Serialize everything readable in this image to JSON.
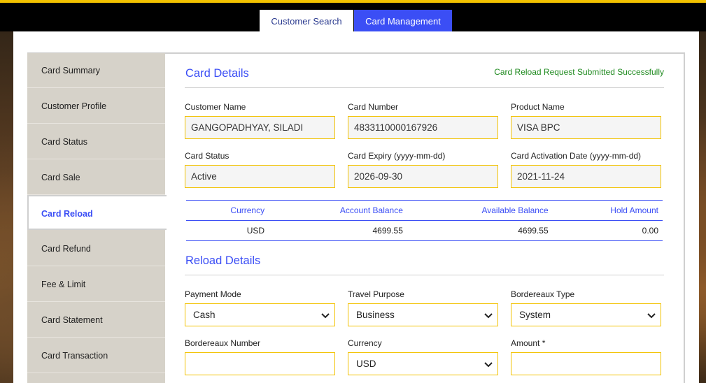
{
  "tabs": {
    "customer_search": "Customer Search",
    "card_management": "Card Management"
  },
  "sidebar": {
    "items": [
      {
        "label": "Card Summary"
      },
      {
        "label": "Customer Profile"
      },
      {
        "label": "Card Status"
      },
      {
        "label": "Card Sale"
      },
      {
        "label": "Card Reload",
        "active": true
      },
      {
        "label": "Card Refund"
      },
      {
        "label": "Fee & Limit"
      },
      {
        "label": "Card Statement"
      },
      {
        "label": "Card Transaction"
      }
    ]
  },
  "card_details": {
    "title": "Card Details",
    "success_message": "Card Reload Request Submitted Successfully",
    "customer_name": {
      "label": "Customer Name",
      "value": "GANGOPADHYAY, SILADI"
    },
    "card_number": {
      "label": "Card Number",
      "value": "4833110000167926"
    },
    "product_name": {
      "label": "Product Name",
      "value": "VISA BPC"
    },
    "card_status": {
      "label": "Card Status",
      "value": "Active"
    },
    "card_expiry": {
      "label": "Card Expiry (yyyy-mm-dd)",
      "value": "2026-09-30"
    },
    "activation_date": {
      "label": "Card Activation Date (yyyy-mm-dd)",
      "value": "2021-11-24"
    }
  },
  "balance_table": {
    "headers": [
      "Currency",
      "Account Balance",
      "Available Balance",
      "Hold Amount"
    ],
    "rows": [
      [
        "USD",
        "4699.55",
        "4699.55",
        "0.00"
      ]
    ]
  },
  "reload_details": {
    "title": "Reload Details",
    "payment_mode": {
      "label": "Payment Mode",
      "value": "Cash"
    },
    "travel_purpose": {
      "label": "Travel Purpose",
      "value": "Business"
    },
    "bordereaux_type": {
      "label": "Bordereaux Type",
      "value": "System"
    },
    "bordereaux_number": {
      "label": "Bordereaux Number",
      "value": ""
    },
    "currency": {
      "label": "Currency",
      "value": "USD"
    },
    "amount": {
      "label": "Amount *",
      "value": ""
    }
  },
  "colors": {
    "accent": "#3b4ef5",
    "field_border": "#f2c200",
    "success": "#1f8a1f",
    "sidebar_bg": "#d6d2c9"
  }
}
